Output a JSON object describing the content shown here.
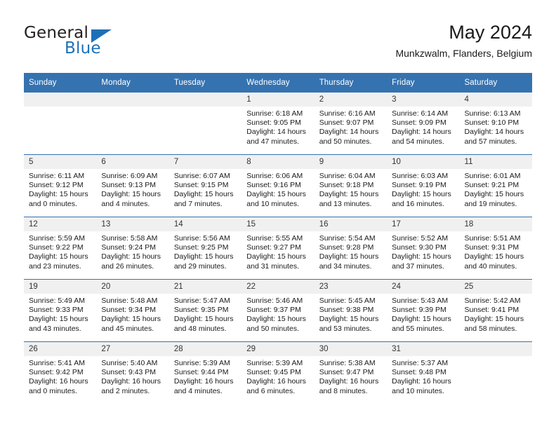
{
  "brand": {
    "name_dark": "General",
    "name_light": "Blue",
    "triangle_color": "#1d70b8"
  },
  "header": {
    "month_title": "May 2024",
    "location": "Munkzwalm, Flanders, Belgium"
  },
  "theme": {
    "header_blue": "#3572b0",
    "daynum_band": "#f0f0f0",
    "text": "#1a1a1a"
  },
  "weekday_headers": [
    "Sunday",
    "Monday",
    "Tuesday",
    "Wednesday",
    "Thursday",
    "Friday",
    "Saturday"
  ],
  "weeks": [
    [
      {
        "day": "",
        "sunrise": "",
        "sunset": "",
        "daylight_line1": "",
        "daylight_line2": "",
        "empty": true
      },
      {
        "day": "",
        "sunrise": "",
        "sunset": "",
        "daylight_line1": "",
        "daylight_line2": "",
        "empty": true
      },
      {
        "day": "",
        "sunrise": "",
        "sunset": "",
        "daylight_line1": "",
        "daylight_line2": "",
        "empty": true
      },
      {
        "day": "1",
        "sunrise": "Sunrise: 6:18 AM",
        "sunset": "Sunset: 9:05 PM",
        "daylight_line1": "Daylight: 14 hours",
        "daylight_line2": "and 47 minutes."
      },
      {
        "day": "2",
        "sunrise": "Sunrise: 6:16 AM",
        "sunset": "Sunset: 9:07 PM",
        "daylight_line1": "Daylight: 14 hours",
        "daylight_line2": "and 50 minutes."
      },
      {
        "day": "3",
        "sunrise": "Sunrise: 6:14 AM",
        "sunset": "Sunset: 9:09 PM",
        "daylight_line1": "Daylight: 14 hours",
        "daylight_line2": "and 54 minutes."
      },
      {
        "day": "4",
        "sunrise": "Sunrise: 6:13 AM",
        "sunset": "Sunset: 9:10 PM",
        "daylight_line1": "Daylight: 14 hours",
        "daylight_line2": "and 57 minutes."
      }
    ],
    [
      {
        "day": "5",
        "sunrise": "Sunrise: 6:11 AM",
        "sunset": "Sunset: 9:12 PM",
        "daylight_line1": "Daylight: 15 hours",
        "daylight_line2": "and 0 minutes."
      },
      {
        "day": "6",
        "sunrise": "Sunrise: 6:09 AM",
        "sunset": "Sunset: 9:13 PM",
        "daylight_line1": "Daylight: 15 hours",
        "daylight_line2": "and 4 minutes."
      },
      {
        "day": "7",
        "sunrise": "Sunrise: 6:07 AM",
        "sunset": "Sunset: 9:15 PM",
        "daylight_line1": "Daylight: 15 hours",
        "daylight_line2": "and 7 minutes."
      },
      {
        "day": "8",
        "sunrise": "Sunrise: 6:06 AM",
        "sunset": "Sunset: 9:16 PM",
        "daylight_line1": "Daylight: 15 hours",
        "daylight_line2": "and 10 minutes."
      },
      {
        "day": "9",
        "sunrise": "Sunrise: 6:04 AM",
        "sunset": "Sunset: 9:18 PM",
        "daylight_line1": "Daylight: 15 hours",
        "daylight_line2": "and 13 minutes."
      },
      {
        "day": "10",
        "sunrise": "Sunrise: 6:03 AM",
        "sunset": "Sunset: 9:19 PM",
        "daylight_line1": "Daylight: 15 hours",
        "daylight_line2": "and 16 minutes."
      },
      {
        "day": "11",
        "sunrise": "Sunrise: 6:01 AM",
        "sunset": "Sunset: 9:21 PM",
        "daylight_line1": "Daylight: 15 hours",
        "daylight_line2": "and 19 minutes."
      }
    ],
    [
      {
        "day": "12",
        "sunrise": "Sunrise: 5:59 AM",
        "sunset": "Sunset: 9:22 PM",
        "daylight_line1": "Daylight: 15 hours",
        "daylight_line2": "and 23 minutes."
      },
      {
        "day": "13",
        "sunrise": "Sunrise: 5:58 AM",
        "sunset": "Sunset: 9:24 PM",
        "daylight_line1": "Daylight: 15 hours",
        "daylight_line2": "and 26 minutes."
      },
      {
        "day": "14",
        "sunrise": "Sunrise: 5:56 AM",
        "sunset": "Sunset: 9:25 PM",
        "daylight_line1": "Daylight: 15 hours",
        "daylight_line2": "and 29 minutes."
      },
      {
        "day": "15",
        "sunrise": "Sunrise: 5:55 AM",
        "sunset": "Sunset: 9:27 PM",
        "daylight_line1": "Daylight: 15 hours",
        "daylight_line2": "and 31 minutes."
      },
      {
        "day": "16",
        "sunrise": "Sunrise: 5:54 AM",
        "sunset": "Sunset: 9:28 PM",
        "daylight_line1": "Daylight: 15 hours",
        "daylight_line2": "and 34 minutes."
      },
      {
        "day": "17",
        "sunrise": "Sunrise: 5:52 AM",
        "sunset": "Sunset: 9:30 PM",
        "daylight_line1": "Daylight: 15 hours",
        "daylight_line2": "and 37 minutes."
      },
      {
        "day": "18",
        "sunrise": "Sunrise: 5:51 AM",
        "sunset": "Sunset: 9:31 PM",
        "daylight_line1": "Daylight: 15 hours",
        "daylight_line2": "and 40 minutes."
      }
    ],
    [
      {
        "day": "19",
        "sunrise": "Sunrise: 5:49 AM",
        "sunset": "Sunset: 9:33 PM",
        "daylight_line1": "Daylight: 15 hours",
        "daylight_line2": "and 43 minutes."
      },
      {
        "day": "20",
        "sunrise": "Sunrise: 5:48 AM",
        "sunset": "Sunset: 9:34 PM",
        "daylight_line1": "Daylight: 15 hours",
        "daylight_line2": "and 45 minutes."
      },
      {
        "day": "21",
        "sunrise": "Sunrise: 5:47 AM",
        "sunset": "Sunset: 9:35 PM",
        "daylight_line1": "Daylight: 15 hours",
        "daylight_line2": "and 48 minutes."
      },
      {
        "day": "22",
        "sunrise": "Sunrise: 5:46 AM",
        "sunset": "Sunset: 9:37 PM",
        "daylight_line1": "Daylight: 15 hours",
        "daylight_line2": "and 50 minutes."
      },
      {
        "day": "23",
        "sunrise": "Sunrise: 5:45 AM",
        "sunset": "Sunset: 9:38 PM",
        "daylight_line1": "Daylight: 15 hours",
        "daylight_line2": "and 53 minutes."
      },
      {
        "day": "24",
        "sunrise": "Sunrise: 5:43 AM",
        "sunset": "Sunset: 9:39 PM",
        "daylight_line1": "Daylight: 15 hours",
        "daylight_line2": "and 55 minutes."
      },
      {
        "day": "25",
        "sunrise": "Sunrise: 5:42 AM",
        "sunset": "Sunset: 9:41 PM",
        "daylight_line1": "Daylight: 15 hours",
        "daylight_line2": "and 58 minutes."
      }
    ],
    [
      {
        "day": "26",
        "sunrise": "Sunrise: 5:41 AM",
        "sunset": "Sunset: 9:42 PM",
        "daylight_line1": "Daylight: 16 hours",
        "daylight_line2": "and 0 minutes."
      },
      {
        "day": "27",
        "sunrise": "Sunrise: 5:40 AM",
        "sunset": "Sunset: 9:43 PM",
        "daylight_line1": "Daylight: 16 hours",
        "daylight_line2": "and 2 minutes."
      },
      {
        "day": "28",
        "sunrise": "Sunrise: 5:39 AM",
        "sunset": "Sunset: 9:44 PM",
        "daylight_line1": "Daylight: 16 hours",
        "daylight_line2": "and 4 minutes."
      },
      {
        "day": "29",
        "sunrise": "Sunrise: 5:39 AM",
        "sunset": "Sunset: 9:45 PM",
        "daylight_line1": "Daylight: 16 hours",
        "daylight_line2": "and 6 minutes."
      },
      {
        "day": "30",
        "sunrise": "Sunrise: 5:38 AM",
        "sunset": "Sunset: 9:47 PM",
        "daylight_line1": "Daylight: 16 hours",
        "daylight_line2": "and 8 minutes."
      },
      {
        "day": "31",
        "sunrise": "Sunrise: 5:37 AM",
        "sunset": "Sunset: 9:48 PM",
        "daylight_line1": "Daylight: 16 hours",
        "daylight_line2": "and 10 minutes."
      },
      {
        "day": "",
        "sunrise": "",
        "sunset": "",
        "daylight_line1": "",
        "daylight_line2": "",
        "empty": true
      }
    ]
  ]
}
